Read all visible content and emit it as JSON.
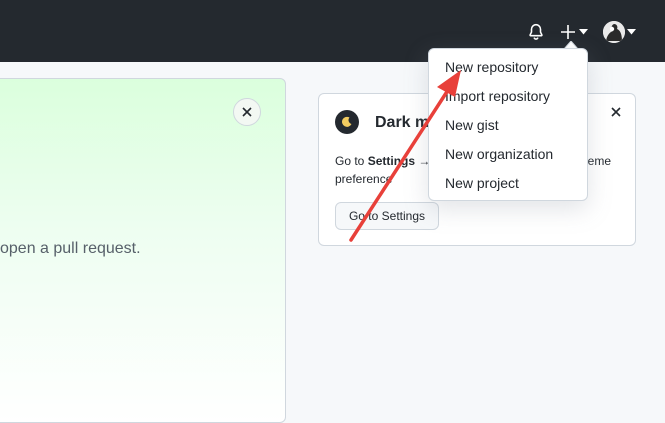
{
  "header": {
    "icons": [
      "bell-icon",
      "plus-icon",
      "caret-down-icon",
      "avatar",
      "caret-down-icon"
    ]
  },
  "promo": {
    "text": "open a pull request."
  },
  "dark_mode_card": {
    "title": "Dark m",
    "body_prefix": "Go to ",
    "body_bold": "Settings",
    "body_arrow": " →",
    "body_suffix": "heme",
    "body_line2": "preference",
    "button_label": "Go to Settings"
  },
  "menu": {
    "items": [
      {
        "label": "New repository"
      },
      {
        "label": "Import repository"
      },
      {
        "label": "New gist"
      },
      {
        "label": "New organization"
      },
      {
        "label": "New project"
      }
    ]
  },
  "colors": {
    "header_bg": "#24292f",
    "annotation_arrow": "#e8403a",
    "promo_gradient_top": "#dbffdd"
  }
}
